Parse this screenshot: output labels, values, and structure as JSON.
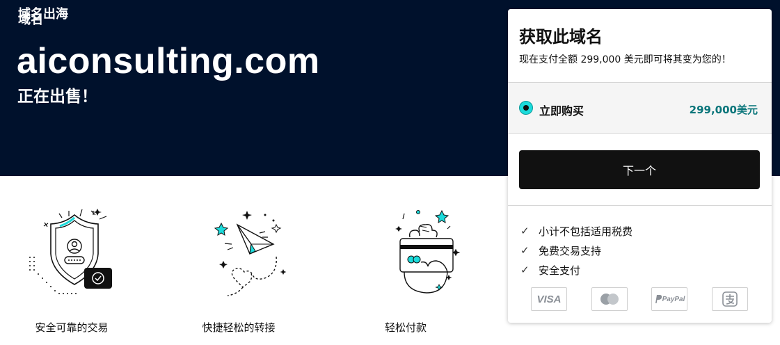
{
  "hero": {
    "brand_line_1": "域名出海",
    "brand_line_2": "域名",
    "domain": "aiconsulting.com",
    "for_sale": "正在出售！"
  },
  "features": [
    {
      "caption": "安全可靠的交易",
      "icon": "shield-user-icon"
    },
    {
      "caption": "快捷轻松的转接",
      "icon": "paper-plane-icon"
    },
    {
      "caption": "轻松付款",
      "icon": "hand-card-icon"
    }
  ],
  "card": {
    "title": "获取此域名",
    "subtitle": "现在支付全额 299,000 美元即可将其变为您的！",
    "option_label": "立即购买",
    "option_price": "299,000美元",
    "next_button": "下一个",
    "checks": [
      "小计不包括适用税费",
      "免费交易支持",
      "安全支付"
    ],
    "payment_methods": [
      "VISA",
      "mastercard",
      "PayPal",
      "alipay"
    ]
  },
  "colors": {
    "hero_bg": "#00112c",
    "accent_teal": "#1bdbdb",
    "price_teal": "#09757a",
    "button_bg": "#111111"
  }
}
